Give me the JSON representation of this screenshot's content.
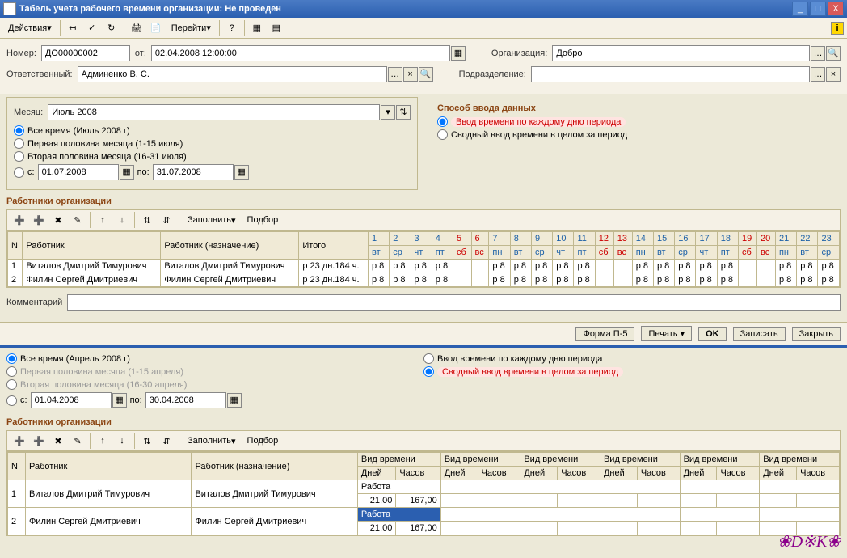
{
  "window": {
    "title": "Табель учета рабочего времени организации: Не проведен"
  },
  "menus": {
    "actions": "Действия",
    "goto": "Перейти",
    "fill": "Заполнить",
    "pick": "Подбор"
  },
  "header": {
    "number_label": "Номер:",
    "number": "ДО00000002",
    "from_label": "от:",
    "from": "02.04.2008 12:00:00",
    "org_label": "Организация:",
    "org": "Добро",
    "resp_label": "Ответственный:",
    "resp": "Админенко В. С.",
    "dept_label": "Подразделение:",
    "dept": ""
  },
  "period": {
    "month_label": "Месяц:",
    "month": "Июль 2008",
    "all": "Все время (Июль 2008 г)",
    "first": "Первая половина месяца (1-15 июля)",
    "second": "Вторая половина месяца (16-31 июля)",
    "from_lbl": "с:",
    "from": "01.07.2008",
    "to_lbl": "по:",
    "to": "31.07.2008"
  },
  "input_method": {
    "title": "Способ ввода данных",
    "daily": "Ввод времени по каждому дню периода",
    "summary": "Сводный ввод времени в целом за период"
  },
  "workers": {
    "title": "Работники организации"
  },
  "th": {
    "n": "N",
    "worker": "Работник",
    "worker2": "Работник (назначение)",
    "total": "Итого",
    "days": [
      "1",
      "2",
      "3",
      "4",
      "5",
      "6",
      "7",
      "8",
      "9",
      "10",
      "11",
      "12",
      "13",
      "14",
      "15",
      "16",
      "17",
      "18",
      "19",
      "20",
      "21",
      "22",
      "23"
    ],
    "wd": [
      "вт",
      "ср",
      "чт",
      "пт",
      "сб",
      "вс",
      "пн",
      "вт",
      "ср",
      "чт",
      "пт",
      "сб",
      "вс",
      "пн",
      "вт",
      "ср",
      "чт",
      "пт",
      "сб",
      "вс",
      "пн",
      "вт",
      "ср"
    ]
  },
  "rows": [
    {
      "n": "1",
      "w": "Виталов Дмитрий Тимурович",
      "t": "р 23 дн.184 ч.",
      "c": [
        "р 8",
        "р 8",
        "р 8",
        "р 8",
        "",
        "",
        "р 8",
        "р 8",
        "р 8",
        "р 8",
        "р 8",
        "",
        "",
        "р 8",
        "р 8",
        "р 8",
        "р 8",
        "р 8",
        "",
        "",
        "р 8",
        "р 8",
        "р 8"
      ]
    },
    {
      "n": "2",
      "w": "Филин Сергей Дмитриевич",
      "t": "р 23 дн.184 ч.",
      "c": [
        "р 8",
        "р 8",
        "р 8",
        "р 8",
        "",
        "",
        "р 8",
        "р 8",
        "р 8",
        "р 8",
        "р 8",
        "",
        "",
        "р 8",
        "р 8",
        "р 8",
        "р 8",
        "р 8",
        "",
        "",
        "р 8",
        "р 8",
        "р 8"
      ]
    }
  ],
  "comment_label": "Комментарий",
  "footer": {
    "form": "Форма П-5",
    "print": "Печать",
    "ok": "OK",
    "save": "Записать",
    "close": "Закрыть"
  },
  "lower": {
    "all": "Все время (Апрель 2008 г)",
    "first": "Первая половина месяца (1-15 апреля)",
    "second": "Вторая половина месяца (16-30 апреля)",
    "from": "01.04.2008",
    "to": "30.04.2008"
  },
  "th2": {
    "type": "Вид времени",
    "days": "Дней",
    "hours": "Часов"
  },
  "rows2": [
    {
      "n": "1",
      "w": "Виталов Дмитрий Тимурович",
      "type": "Работа",
      "d": "21,00",
      "h": "167,00"
    },
    {
      "n": "2",
      "w": "Филин Сергей Дмитриевич",
      "type": "Работа",
      "d": "21,00",
      "h": "167,00"
    }
  ]
}
